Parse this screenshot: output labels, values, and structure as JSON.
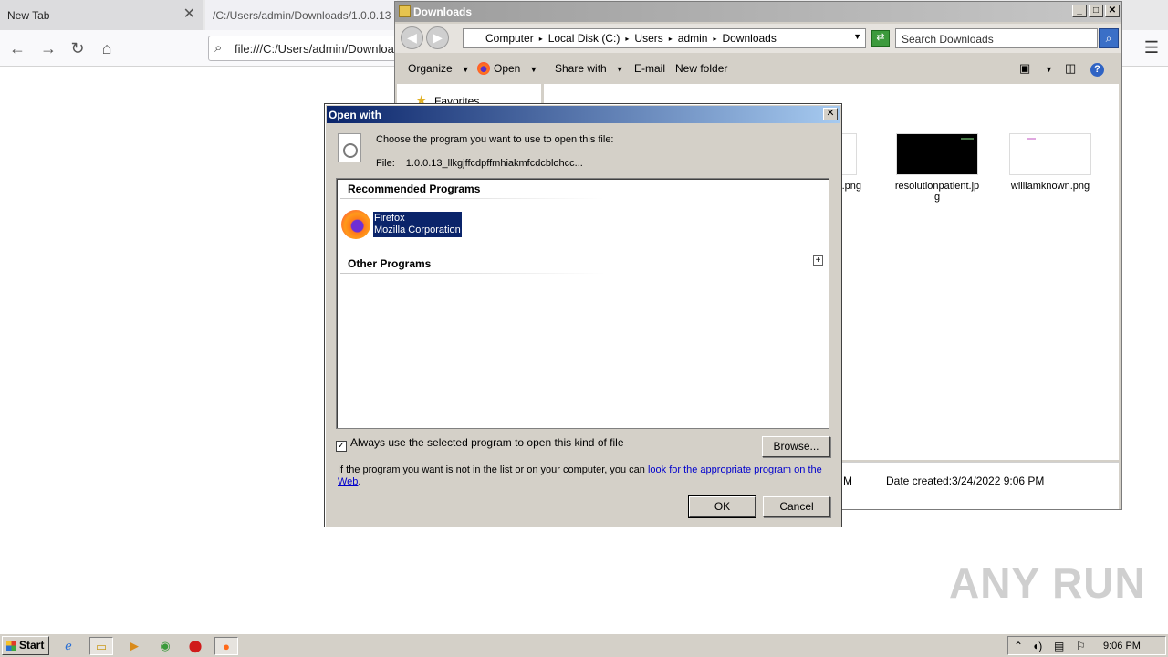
{
  "browser": {
    "tabs": [
      {
        "label": "New Tab"
      },
      {
        "label": "/C:/Users/admin/Downloads/1.0.0.13"
      }
    ],
    "url": "file:///C:/Users/admin/Downloads"
  },
  "explorer": {
    "title": "Downloads",
    "breadcrumbs": [
      "Computer",
      "Local Disk (C:)",
      "Users",
      "admin",
      "Downloads"
    ],
    "search_placeholder": "Search Downloads",
    "toolbar": {
      "organize": "Organize",
      "open": "Open",
      "share_with": "Share with",
      "email": "E-mail",
      "new_folder": "New folder"
    },
    "nav": {
      "favorites": "Favorites"
    },
    "files": [
      {
        "name": ".png"
      },
      {
        "name": "resolutionpatient.jpg"
      },
      {
        "name": "williamknown.png"
      }
    ],
    "details": {
      "fragment": "M",
      "date_created_label": "Date created:",
      "date_created_value": "3/24/2022 9:06 PM"
    }
  },
  "dialog": {
    "title": "Open with",
    "prompt": "Choose the program you want to use to open this file:",
    "file_label": "File:",
    "file_name": "1.0.0.13_llkgjffcdpffmhiakmfcdcblohcc...",
    "recommended_header": "Recommended Programs",
    "selected_program": {
      "name": "Firefox",
      "publisher": "Mozilla Corporation"
    },
    "other_header": "Other Programs",
    "always_use_label": "Always use the selected program to open this kind of file",
    "always_use_checked": true,
    "browse_label": "Browse...",
    "help_text_prefix": "If the program you want is not in the list or on your computer, you can ",
    "help_link_text": "look for the appropriate program on the Web",
    "help_text_suffix": ".",
    "ok_label": "OK",
    "cancel_label": "Cancel"
  },
  "taskbar": {
    "start_label": "Start",
    "clock": "9:06 PM"
  },
  "watermark": "ANY RUN"
}
